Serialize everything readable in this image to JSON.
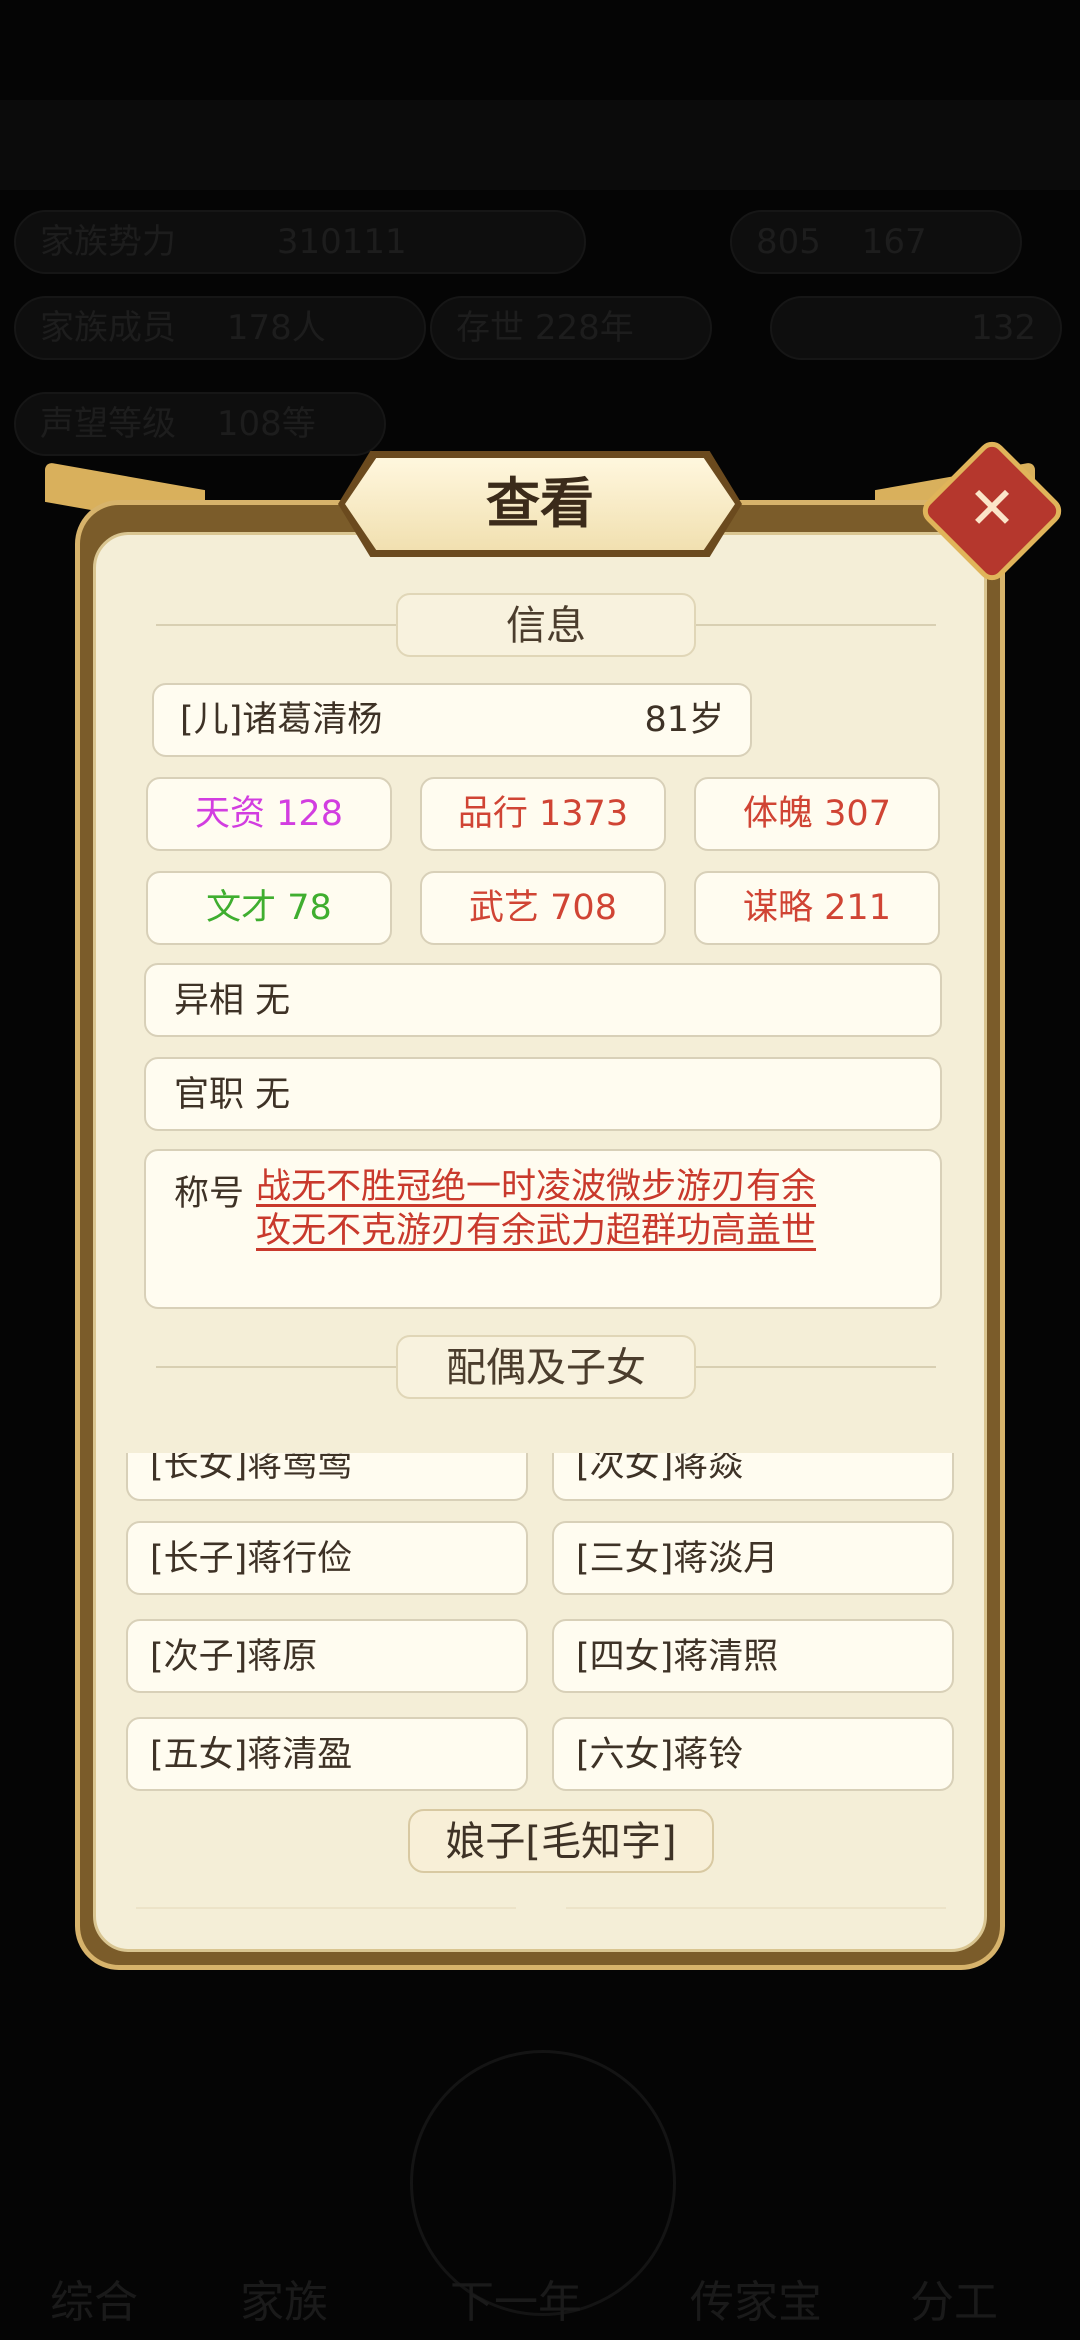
{
  "background": {
    "pills": [
      "家族势力",
      "310111",
      "805",
      "167",
      "家族成员",
      "178人",
      "存世",
      "228年",
      "132",
      "声望等级",
      "108等"
    ],
    "nav": [
      "综合",
      "家族",
      "下一年",
      "传家宝",
      "分工"
    ]
  },
  "dialog": {
    "title": "查看",
    "close": "✕",
    "info_header": "信息",
    "person": {
      "name": "[儿]诸葛清杨",
      "age": "81岁"
    },
    "stats": [
      {
        "label": "天资 128",
        "color": "#d23de0"
      },
      {
        "label": "品行 1373",
        "color": "#d04434"
      },
      {
        "label": "体魄 307",
        "color": "#d04434"
      },
      {
        "label": "文才 78",
        "color": "#3fae2f"
      },
      {
        "label": "武艺 708",
        "color": "#d04434"
      },
      {
        "label": "谋略 211",
        "color": "#d04434"
      }
    ],
    "appearance": "异相 无",
    "office": "官职 无",
    "title_label": "称号",
    "title_lines": [
      "战无不胜冠绝一时凌波微步游刃有余",
      "攻无不克游刃有余武力超群功高盖世"
    ],
    "family_header": "配偶及子女",
    "children_partial": [
      "[长女]蒋莺莺",
      "[次女]蒋焱"
    ],
    "children": [
      [
        "[长子]蒋行俭",
        "[三女]蒋淡月"
      ],
      [
        "[次子]蒋原",
        "[四女]蒋清照"
      ],
      [
        "[五女]蒋清盈",
        "[六女]蒋铃"
      ]
    ],
    "spouse": "娘子[毛知字]"
  }
}
